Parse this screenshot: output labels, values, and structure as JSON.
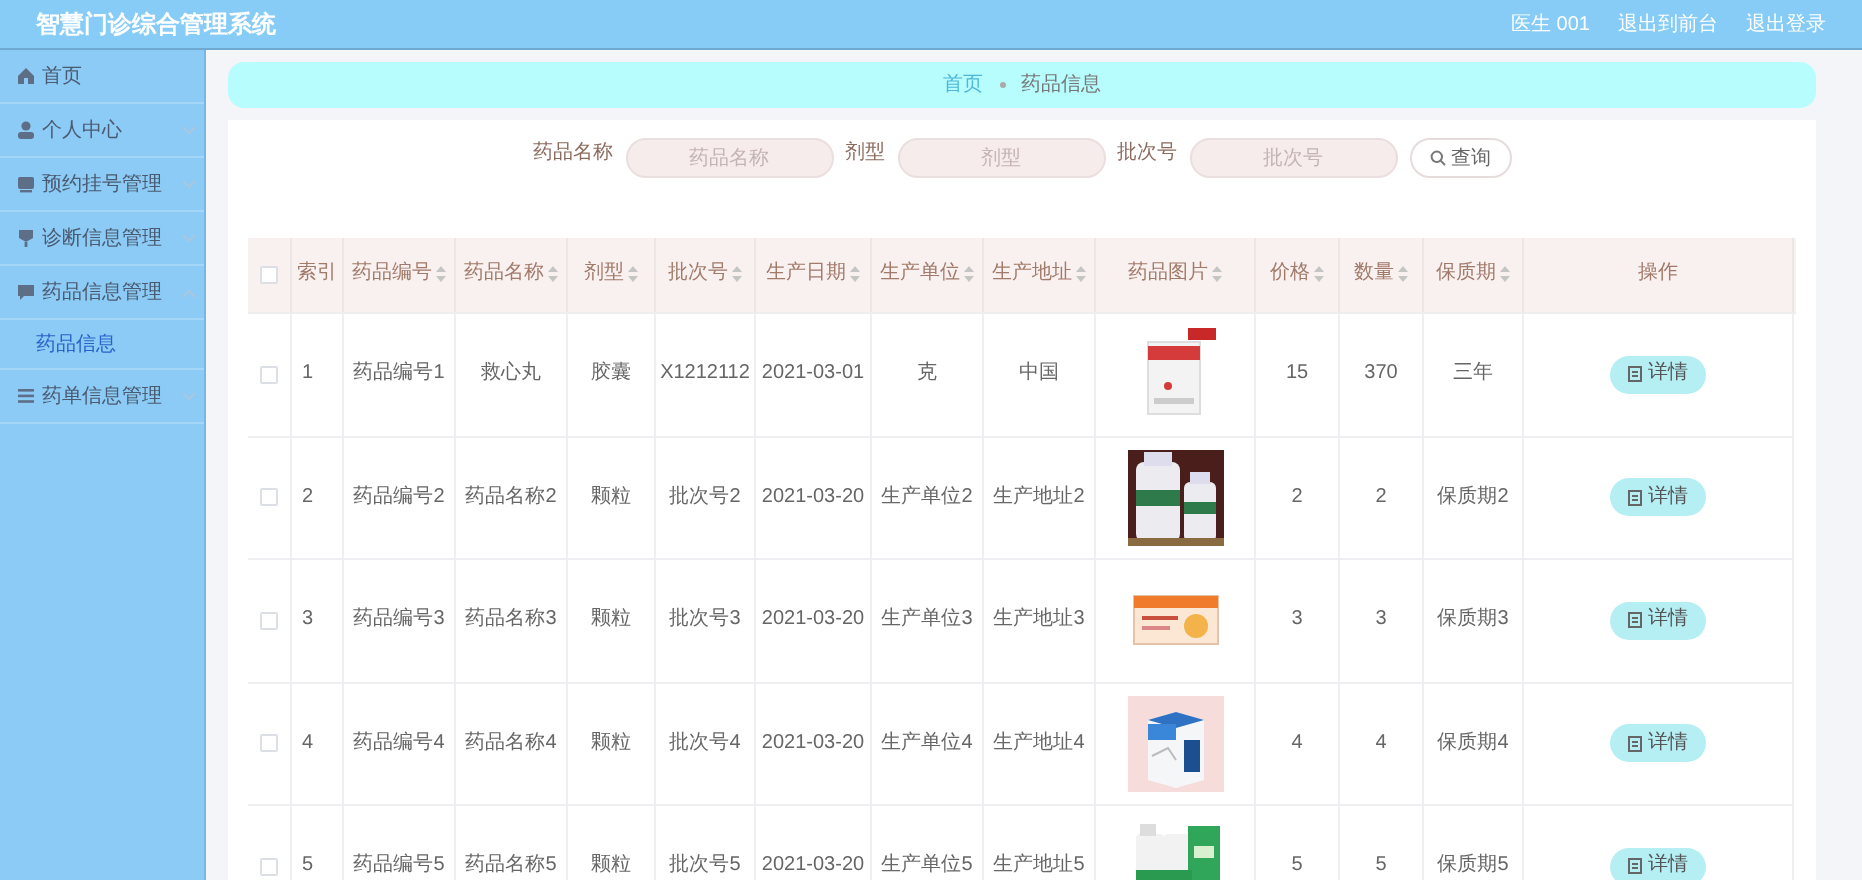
{
  "header": {
    "title": "智慧门诊综合管理系统",
    "user": "医生 001",
    "links": [
      "退出到前台",
      "退出登录"
    ]
  },
  "sidebar": {
    "items": [
      {
        "label": "首页",
        "kind": "link"
      },
      {
        "label": "个人中心",
        "kind": "menu",
        "expanded": false
      },
      {
        "label": "预约挂号管理",
        "kind": "menu",
        "expanded": false
      },
      {
        "label": "诊断信息管理",
        "kind": "menu",
        "expanded": false
      },
      {
        "label": "药品信息管理",
        "kind": "menu",
        "expanded": true,
        "children": [
          {
            "label": "药品信息",
            "selected": true
          }
        ]
      },
      {
        "label": "药单信息管理",
        "kind": "menu",
        "expanded": false
      }
    ]
  },
  "breadcrumb": [
    "首页",
    "药品信息"
  ],
  "search": {
    "fields": [
      {
        "label": "药品名称",
        "placeholder": "药品名称"
      },
      {
        "label": "剂型",
        "placeholder": "剂型"
      },
      {
        "label": "批次号",
        "placeholder": "批次号"
      }
    ],
    "button": "查询"
  },
  "table": {
    "all_checked": false,
    "columns": [
      {
        "label": "索引",
        "sortable": false
      },
      {
        "label": "药品编号",
        "sortable": true
      },
      {
        "label": "药品名称",
        "sortable": true
      },
      {
        "label": "剂型",
        "sortable": true
      },
      {
        "label": "批次号",
        "sortable": true
      },
      {
        "label": "生产日期",
        "sortable": true
      },
      {
        "label": "生产单位",
        "sortable": true
      },
      {
        "label": "生产地址",
        "sortable": true
      },
      {
        "label": "药品图片",
        "sortable": true
      },
      {
        "label": "价格",
        "sortable": true
      },
      {
        "label": "数量",
        "sortable": true
      },
      {
        "label": "保质期",
        "sortable": true
      },
      {
        "label": "操作",
        "sortable": false
      }
    ],
    "rows": [
      {
        "checked": false,
        "cells": [
          "1",
          "药品编号1",
          "救心丸",
          "胶囊",
          "X1212112",
          "2021-03-01",
          "克",
          "中国"
        ],
        "rest": [
          "15",
          "370",
          "三年"
        ],
        "action": "详情"
      },
      {
        "checked": false,
        "cells": [
          "2",
          "药品编号2",
          "药品名称2",
          "颗粒",
          "批次号2",
          "2021-03-20",
          "生产单位2",
          "生产地址2"
        ],
        "rest": [
          "2",
          "2",
          "保质期2"
        ],
        "action": "详情"
      },
      {
        "checked": false,
        "cells": [
          "3",
          "药品编号3",
          "药品名称3",
          "颗粒",
          "批次号3",
          "2021-03-20",
          "生产单位3",
          "生产地址3"
        ],
        "rest": [
          "3",
          "3",
          "保质期3"
        ],
        "action": "详情"
      },
      {
        "checked": false,
        "cells": [
          "4",
          "药品编号4",
          "药品名称4",
          "颗粒",
          "批次号4",
          "2021-03-20",
          "生产单位4",
          "生产地址4"
        ],
        "rest": [
          "4",
          "4",
          "保质期4"
        ],
        "action": "详情"
      },
      {
        "checked": false,
        "cells": [
          "5",
          "药品编号5",
          "药品名称5",
          "颗粒",
          "批次号5",
          "2021-03-20",
          "生产单位5",
          "生产地址5"
        ],
        "rest": [
          "5",
          "5",
          "保质期5"
        ],
        "action": "详情"
      }
    ]
  }
}
